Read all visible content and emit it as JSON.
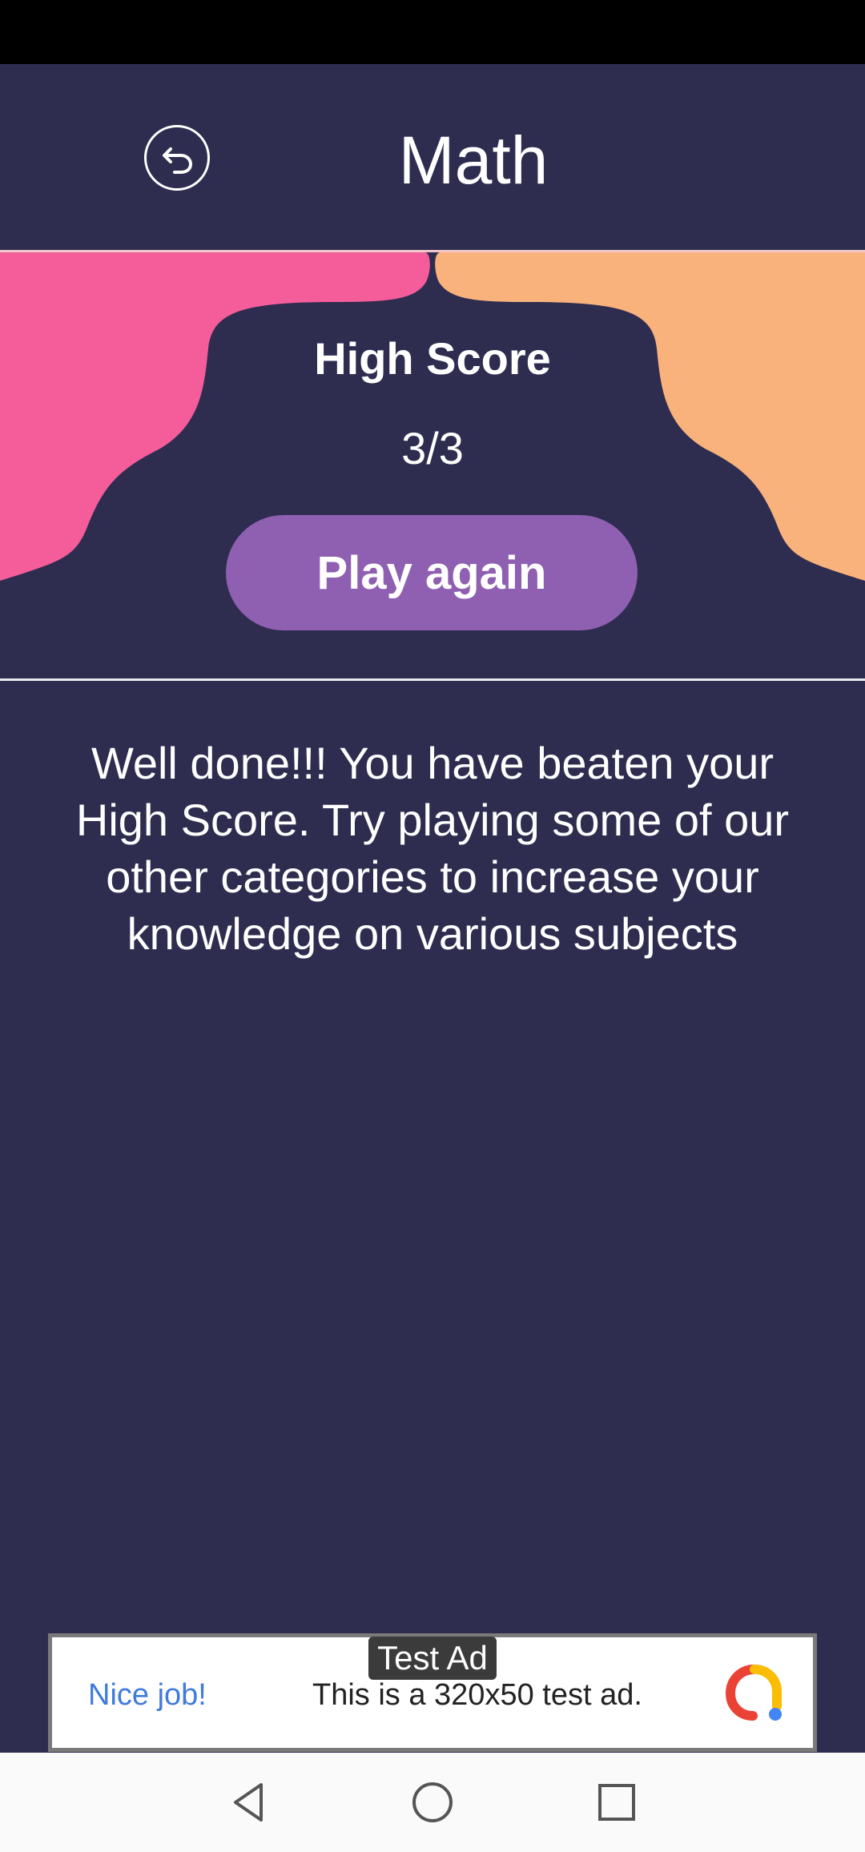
{
  "header": {
    "title": "Math",
    "back_icon": "undo-arrow-icon"
  },
  "score": {
    "label": "High Score",
    "value": "3/3"
  },
  "actions": {
    "play_again_label": "Play again"
  },
  "message": "Well done!!! You have beaten your High Score. Try playing some of our other categories to increase your knowledge on various subjects",
  "ad": {
    "badge": "Test Ad",
    "nice": "Nice job!",
    "text": "This is a 320x50 test ad."
  },
  "nav": {
    "back_icon": "nav-back-icon",
    "home_icon": "nav-home-icon",
    "recents_icon": "nav-recents-icon"
  },
  "colors": {
    "background": "#2e2d50",
    "pink": "#f55d9a",
    "peach": "#f9b27c",
    "button": "#8f5fb1"
  }
}
